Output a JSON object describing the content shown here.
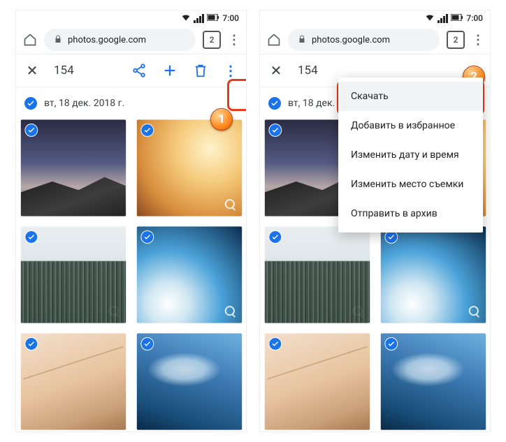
{
  "status": {
    "time": "7:00"
  },
  "chrome": {
    "url": "photos.google.com",
    "tab_count": "2"
  },
  "selection": {
    "count": "154"
  },
  "date": {
    "label": "вт, 18 дек. 2018 г."
  },
  "menu": {
    "items": [
      "Скачать",
      "Добавить в избранное",
      "Изменить дату и время",
      "Изменить место съемки",
      "Отправить в архив"
    ]
  },
  "annotations": {
    "marker1": "1",
    "marker2": "2"
  }
}
